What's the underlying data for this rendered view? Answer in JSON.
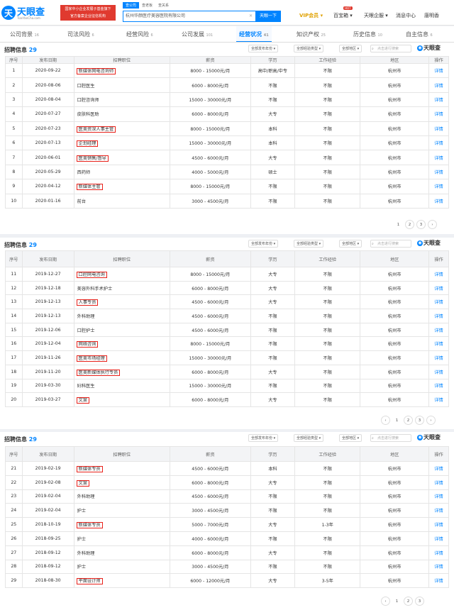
{
  "header": {
    "logo_glyph": "天",
    "logo_text": "天眼查",
    "logo_sub": "TianYanCha.com",
    "banner_line1": "国家中小企业发展子基金旗下",
    "banner_line2": "官方备案企业征信机构",
    "search_tabs": [
      "查公司",
      "查老板",
      "查关系"
    ],
    "search_value": "杭州华颜医疗美容医院有限公司",
    "search_button": "天眼一下",
    "nav_vip": "VIP会员",
    "nav_hot": "HOT",
    "nav_treasure": "百宝箱",
    "nav_enterprise": "天眼企服",
    "nav_message": "消息中心",
    "nav_user": "唐明香"
  },
  "tabs": [
    {
      "label": "公司背景",
      "count": "16"
    },
    {
      "label": "司法风险",
      "count": "6"
    },
    {
      "label": "经营风险",
      "count": "6"
    },
    {
      "label": "公司发展",
      "count": "101"
    },
    {
      "label": "经营状况",
      "count": "41"
    },
    {
      "label": "知识产权",
      "count": "25"
    },
    {
      "label": "历史信息",
      "count": "10"
    },
    {
      "label": "自主信息",
      "count": "6"
    }
  ],
  "panel_common": {
    "title": "招聘信息",
    "count": "29",
    "filter_year": "全部发布年份 ▾",
    "filter_exp": "全部经验类型 ▾",
    "filter_area": "全部地区 ▾",
    "search_placeholder": "点击进行搜索",
    "watermark": "天眼查",
    "columns": [
      "序号",
      "发布日期",
      "招聘职位",
      "薪资",
      "学历",
      "工作经验",
      "地区",
      "操作"
    ],
    "op_label": "详情"
  },
  "panels": [
    {
      "rows": [
        [
          "1",
          "2020-09-22",
          "新媒体网电咨询师",
          "8000 - 15000元/月",
          "高中/职高/中专",
          "不限",
          "杭州市"
        ],
        [
          "2",
          "2020-08-06",
          "口腔医生",
          "6000 - 8000元/月",
          "不限",
          "不限",
          "杭州市"
        ],
        [
          "3",
          "2020-08-04",
          "口腔咨询师",
          "15000 - 30000元/月",
          "不限",
          "不限",
          "杭州市"
        ],
        [
          "4",
          "2020-07-27",
          "皮肤科医助",
          "6000 - 8000元/月",
          "大专",
          "不限",
          "杭州市"
        ],
        [
          "5",
          "2020-07-23",
          "医美资深人事主管",
          "8000 - 15000元/月",
          "本科",
          "不限",
          "杭州市"
        ],
        [
          "6",
          "2020-07-13",
          "企划经理",
          "15000 - 30000元/月",
          "本科",
          "不限",
          "杭州市"
        ],
        [
          "7",
          "2020-06-01",
          "医美销售/督导",
          "4500 - 6000元/月",
          "大专",
          "不限",
          "杭州市"
        ],
        [
          "8",
          "2020-05-29",
          "西药师",
          "4000 - 5000元/月",
          "硕士",
          "不限",
          "杭州市"
        ],
        [
          "9",
          "2020-04-12",
          "新媒体主管",
          "8000 - 15000元/月",
          "不限",
          "不限",
          "杭州市"
        ],
        [
          "10",
          "2020-01-16",
          "前台",
          "3000 - 4500元/月",
          "不限",
          "不限",
          "杭州市"
        ]
      ],
      "highlight": [
        true,
        false,
        false,
        false,
        true,
        true,
        true,
        false,
        true,
        false
      ],
      "pages": [
        "1",
        "2",
        "3",
        "›"
      ]
    },
    {
      "rows": [
        [
          "11",
          "2019-12-27",
          "口腔网电咨询",
          "8000 - 15000元/月",
          "大专",
          "不限",
          "杭州市"
        ],
        [
          "12",
          "2019-12-18",
          "美容外科手术护士",
          "6000 - 8000元/月",
          "大专",
          "不限",
          "杭州市"
        ],
        [
          "13",
          "2019-12-13",
          "人事专员",
          "4500 - 6000元/月",
          "大专",
          "不限",
          "杭州市"
        ],
        [
          "14",
          "2019-12-13",
          "外科助理",
          "4500 - 6000元/月",
          "不限",
          "不限",
          "杭州市"
        ],
        [
          "15",
          "2019-12-06",
          "口腔护士",
          "4500 - 6000元/月",
          "不限",
          "不限",
          "杭州市"
        ],
        [
          "16",
          "2019-12-04",
          "网络咨询",
          "8000 - 15000元/月",
          "不限",
          "不限",
          "杭州市"
        ],
        [
          "17",
          "2019-11-26",
          "医美市场经理",
          "15000 - 30000元/月",
          "不限",
          "不限",
          "杭州市"
        ],
        [
          "18",
          "2019-11-20",
          "医美新媒体执行专员",
          "6000 - 8000元/月",
          "大专",
          "不限",
          "杭州市"
        ],
        [
          "19",
          "2019-03-30",
          "妇科医生",
          "15000 - 30000元/月",
          "不限",
          "不限",
          "杭州市"
        ],
        [
          "20",
          "2019-03-27",
          "文案",
          "6000 - 8000元/月",
          "大专",
          "不限",
          "杭州市"
        ]
      ],
      "highlight": [
        true,
        false,
        true,
        false,
        false,
        true,
        true,
        true,
        false,
        true
      ],
      "pages": [
        "‹",
        "1",
        "2",
        "3",
        "›"
      ]
    },
    {
      "rows": [
        [
          "21",
          "2019-02-19",
          "新媒体专员",
          "4500 - 6000元/月",
          "本科",
          "不限",
          "杭州市"
        ],
        [
          "22",
          "2019-02-08",
          "文案",
          "6000 - 8000元/月",
          "大专",
          "不限",
          "杭州市"
        ],
        [
          "23",
          "2019-02-04",
          "外科助理",
          "4500 - 6000元/月",
          "不限",
          "不限",
          "杭州市"
        ],
        [
          "24",
          "2019-02-04",
          "护士",
          "3000 - 4500元/月",
          "不限",
          "不限",
          "杭州市"
        ],
        [
          "25",
          "2018-10-19",
          "新媒体专员",
          "5000 - 7000元/月",
          "大专",
          "1-3年",
          "杭州市"
        ],
        [
          "26",
          "2018-09-25",
          "护士",
          "4000 - 6000元/月",
          "不限",
          "不限",
          "杭州市"
        ],
        [
          "27",
          "2018-09-12",
          "外科助理",
          "6000 - 8000元/月",
          "大专",
          "不限",
          "杭州市"
        ],
        [
          "28",
          "2018-09-12",
          "护士",
          "3000 - 4500元/月",
          "不限",
          "不限",
          "杭州市"
        ],
        [
          "29",
          "2018-08-30",
          "平面设计师",
          "6000 - 12000元/月",
          "大专",
          "3-5年",
          "杭州市"
        ]
      ],
      "highlight": [
        true,
        true,
        false,
        false,
        true,
        false,
        false,
        false,
        true
      ],
      "pages": [
        "‹",
        "1",
        "2",
        "3"
      ]
    }
  ]
}
